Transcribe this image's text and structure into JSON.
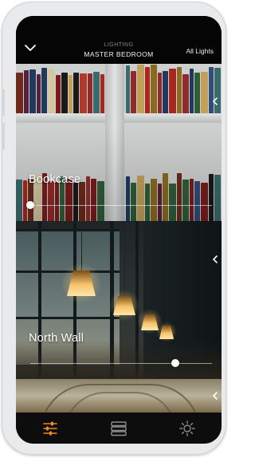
{
  "header": {
    "subtitle": "LIGHTING",
    "title": "MASTER BEDROOM",
    "all_lights_label": "All Lights",
    "back_icon": "chevron-down-icon"
  },
  "zones": [
    {
      "name": "Bookcase",
      "level": 0.0
    },
    {
      "name": "North Wall",
      "level": 0.8
    }
  ],
  "tabs": [
    {
      "icon": "sliders-icon",
      "active": true
    },
    {
      "icon": "scenes-list-icon",
      "active": false
    },
    {
      "icon": "brightness-icon",
      "active": false
    }
  ],
  "colors": {
    "accent": "#f0882c",
    "inactive_icon": "#8d8d8d",
    "header_bg": "#050505",
    "tabbar_bg": "#0d0d0d"
  }
}
